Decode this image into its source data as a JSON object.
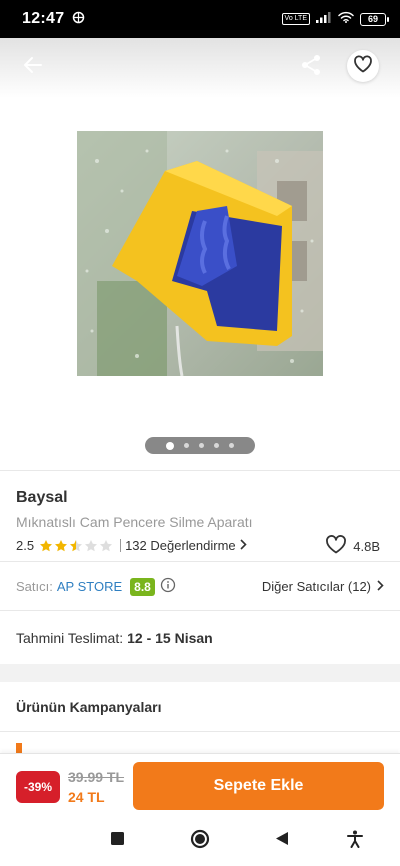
{
  "status_bar": {
    "time": "12:47",
    "network_badge": "Vo LTE",
    "battery": "69"
  },
  "product": {
    "brand": "Baysal",
    "name": "Mıknatıslı Cam Pencere Silme Aparatı",
    "rating": "2.5",
    "rating_stars": 2.5,
    "review_count": "132 Değerlendirme",
    "favorites_count": "4.8B",
    "image_count": 5,
    "image_index": 1
  },
  "seller": {
    "label": "Satıcı:",
    "name": "AP STORE",
    "score": "8.8",
    "other_sellers": "Diğer Satıcılar (12)"
  },
  "delivery": {
    "label": "Tahmini Teslimat:",
    "value": "12 - 15 Nisan"
  },
  "campaigns": {
    "title": "Ürünün Kampanyaları"
  },
  "pricing": {
    "discount": "-39%",
    "old_price": "39.99 TL",
    "new_price": "24 TL",
    "add_to_cart": "Sepete Ekle"
  },
  "colors": {
    "brand_orange": "#f27a1a",
    "discount_red": "#d61f2a",
    "seller_score_green": "#7ab51d",
    "seller_link_blue": "#2f7fc1"
  },
  "icons": {
    "back": "arrow-left-icon",
    "share": "share-icon",
    "favorite": "heart-icon",
    "info": "info-icon",
    "chevron": "chevron-right-icon",
    "nav_recent": "square-icon",
    "nav_home": "circle-icon",
    "nav_back": "triangle-icon",
    "nav_accessibility": "accessibility-icon"
  }
}
